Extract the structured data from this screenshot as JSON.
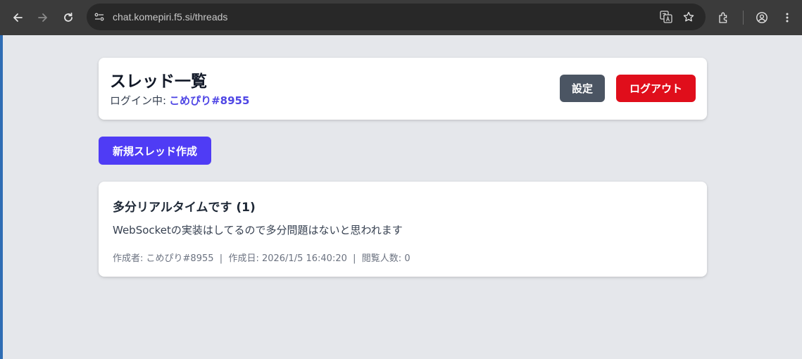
{
  "browser": {
    "url": "chat.komepiri.f5.si/threads"
  },
  "header": {
    "title": "スレッド一覧",
    "login_label": "ログイン中:",
    "username": "こめぴり#8955",
    "settings_label": "設定",
    "logout_label": "ログアウト"
  },
  "actions": {
    "new_thread_label": "新規スレッド作成"
  },
  "threads": [
    {
      "title": "多分リアルタイムです (1)",
      "body": "WebSocketの実装はしてるので多分問題はないと思われます",
      "author_label": "作成者:",
      "author": "こめぴり#8955",
      "separator": "|",
      "created_label": "作成日:",
      "created": "2026/1/5 16:40:20",
      "views_label": "閲覧人数:",
      "views": "0"
    }
  ],
  "colors": {
    "accent": "#4f3cf5",
    "username": "#4f46e5",
    "logout": "#e00e1b",
    "settings": "#4b5563",
    "background": "#e5e7eb"
  }
}
